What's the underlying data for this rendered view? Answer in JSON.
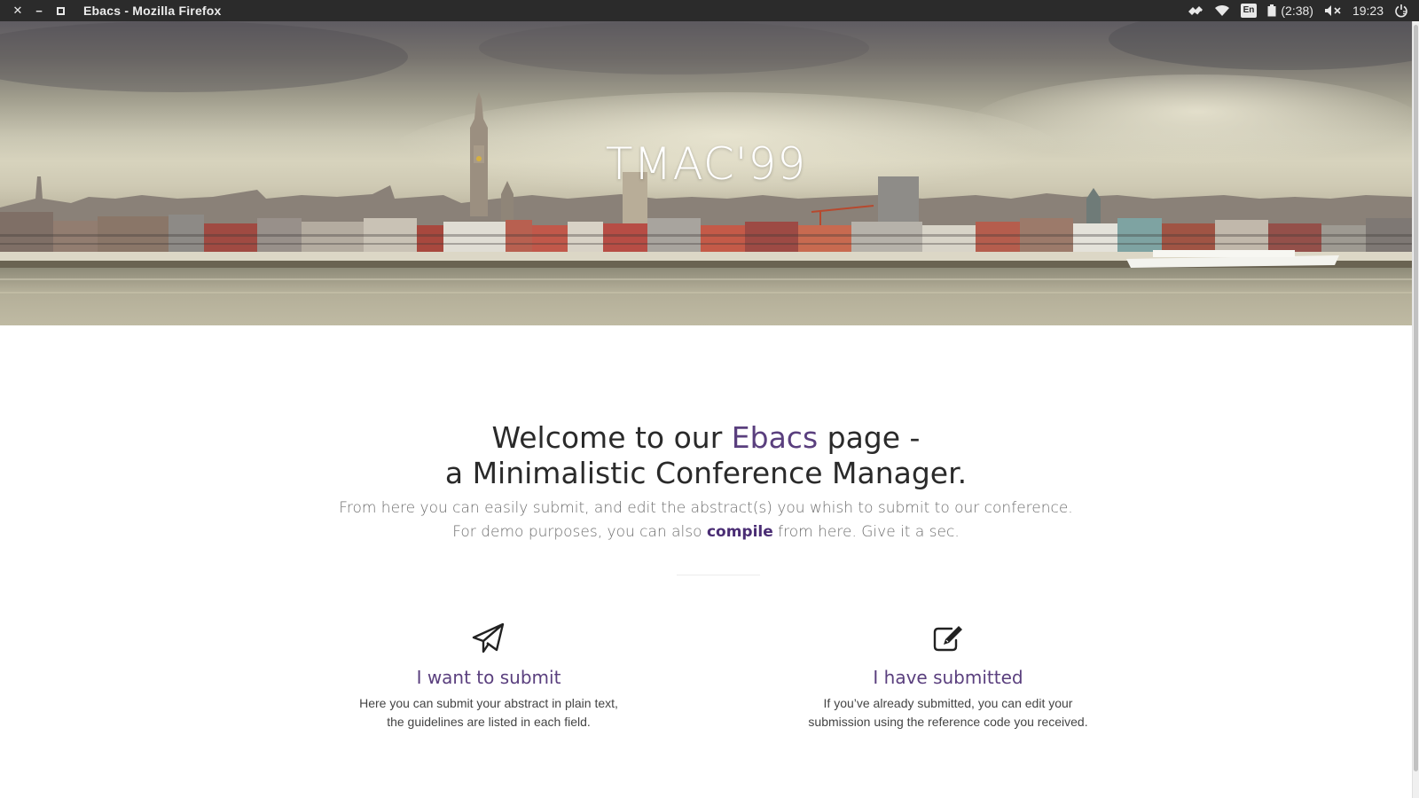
{
  "window": {
    "title": "Ebacs - Mozilla Firefox",
    "controls": [
      "close-icon",
      "minimize-icon",
      "maximize-icon"
    ]
  },
  "tray": {
    "icons": [
      "dropbox-sync-icon",
      "wifi-icon",
      "keyboard-layout-icon",
      "battery-icon",
      "volume-muted-icon",
      "power-icon"
    ],
    "keyboard_layout": "En",
    "battery_time": "(2:38)",
    "clock": "19:23"
  },
  "hero": {
    "title": "TMAC'99"
  },
  "intro": {
    "heading_prefix": "Welcome to our ",
    "heading_brand": "Ebacs",
    "heading_suffix": " page -",
    "heading_line2": "a Minimalistic Conference Manager.",
    "line1": "From here you can easily submit, and edit the abstract(s) you whish to submit to our conference.",
    "line2_prefix": "For demo purposes, you can also ",
    "line2_link": "compile",
    "line2_suffix": " from here. Give it a sec."
  },
  "features": [
    {
      "icon": "paper-plane-icon",
      "title": "I want to submit",
      "desc_line1": "Here you can submit your abstract in plain text,",
      "desc_line2": "the guidelines are listed in each field."
    },
    {
      "icon": "edit-icon",
      "title": "I have submitted",
      "desc_line1": "If you’ve already submitted, you can edit your",
      "desc_line2": "submission using the reference code you received."
    }
  ],
  "colors": {
    "brand": "#5a3f7e",
    "link": "#4a2d74",
    "os_bar": "#2b2b2b"
  }
}
